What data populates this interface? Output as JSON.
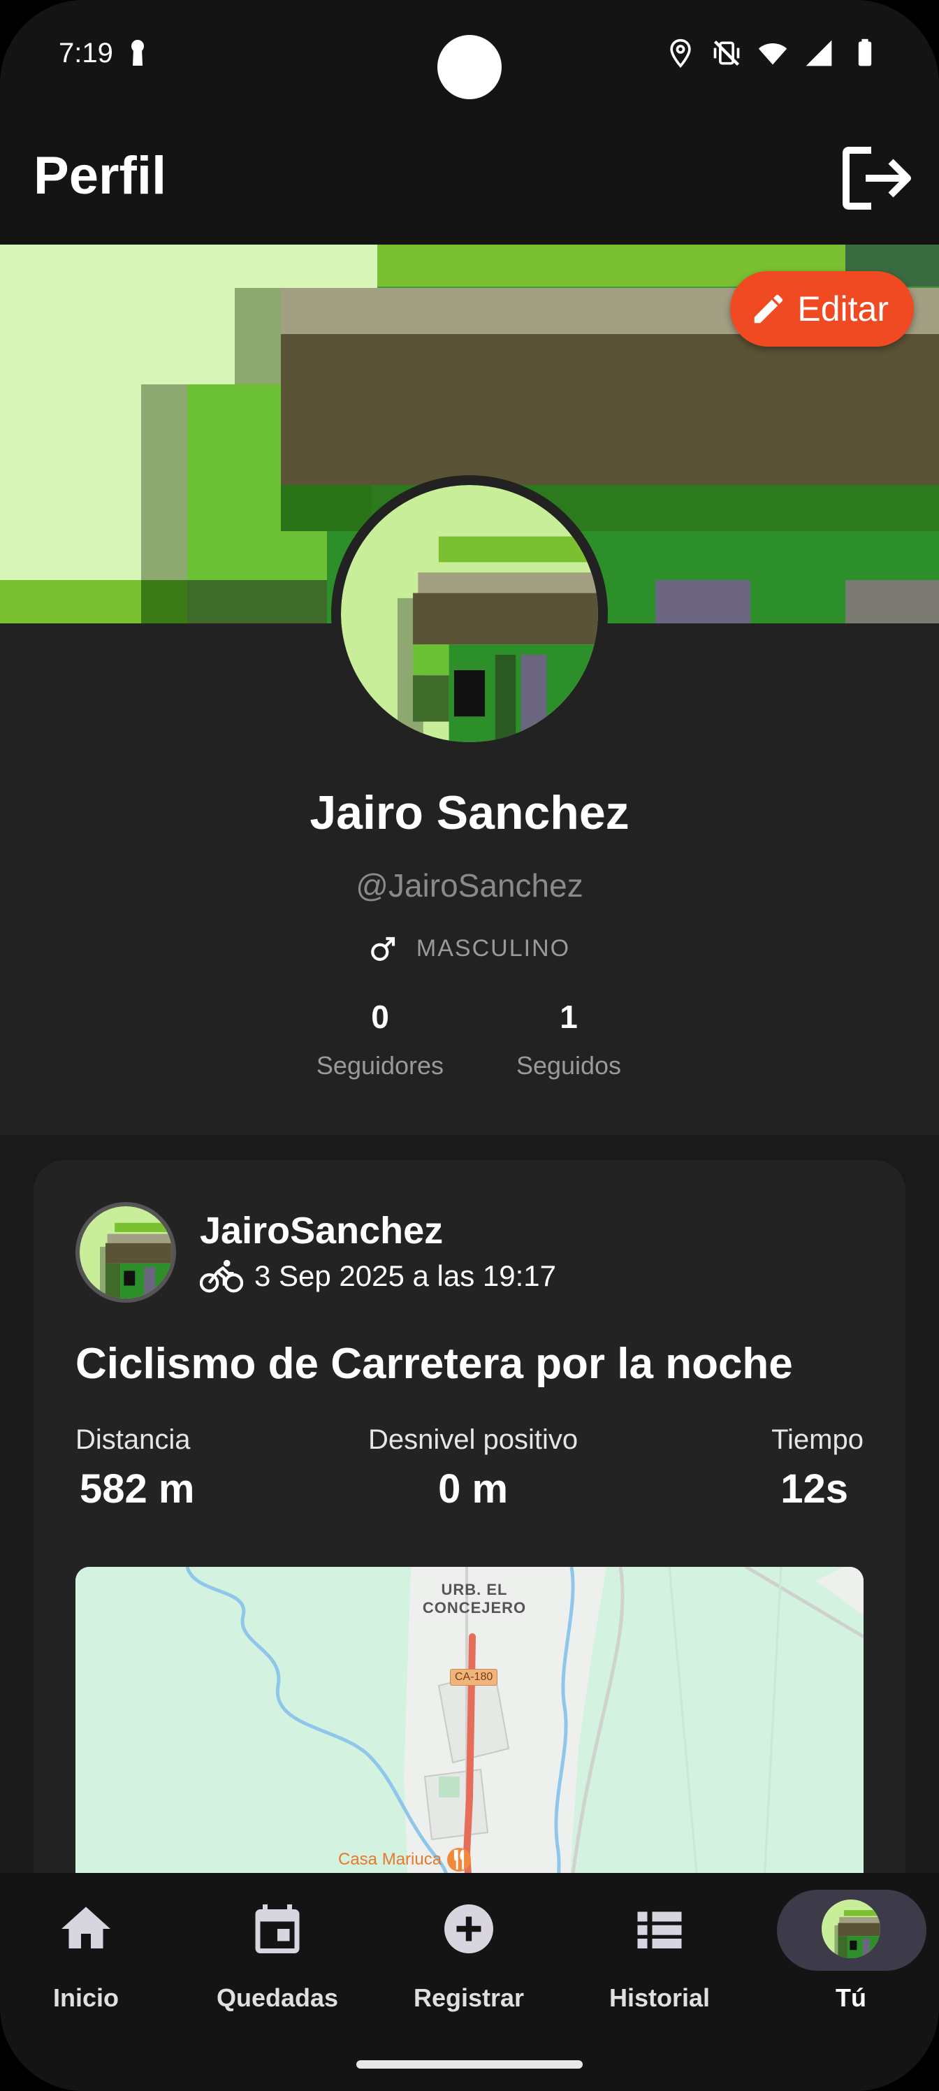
{
  "status_bar": {
    "time": "7:19",
    "icons": [
      "key-icon",
      "location-icon",
      "vibrate-off-icon",
      "wifi-icon",
      "signal-icon",
      "battery-icon"
    ]
  },
  "app_bar": {
    "title": "Perfil",
    "logout_icon": "logout-icon"
  },
  "header": {
    "edit_label": "Editar",
    "edit_icon": "pencil-icon",
    "accent": "#f04a22"
  },
  "profile": {
    "name": "Jairo Sanchez",
    "handle": "@JairoSanchez",
    "gender_icon": "male-icon",
    "gender": "MASCULINO",
    "followers_count": "0",
    "followers_label": "Seguidores",
    "following_count": "1",
    "following_label": "Seguidos"
  },
  "activity": {
    "username": "JairoSanchez",
    "sport_icon": "bicycle-icon",
    "datetime": "3 Sep 2025 a las 19:17",
    "title": "Ciclismo de Carretera por la noche",
    "metrics": [
      {
        "label": "Distancia",
        "value": "582 m"
      },
      {
        "label": "Desnivel positivo",
        "value": "0 m"
      },
      {
        "label": "Tiempo",
        "value": "12s"
      }
    ],
    "map": {
      "place_label": "URB. EL CONCEJERO",
      "road_label": "CA-180",
      "poi_label": "Casa Mariuca"
    }
  },
  "bottom_nav": {
    "items": [
      {
        "label": "Inicio",
        "icon": "home-icon"
      },
      {
        "label": "Quedadas",
        "icon": "calendar-icon"
      },
      {
        "label": "Registrar",
        "icon": "add-circle-icon"
      },
      {
        "label": "Historial",
        "icon": "list-icon"
      },
      {
        "label": "Tú",
        "icon": "avatar-icon",
        "active": true
      }
    ]
  }
}
